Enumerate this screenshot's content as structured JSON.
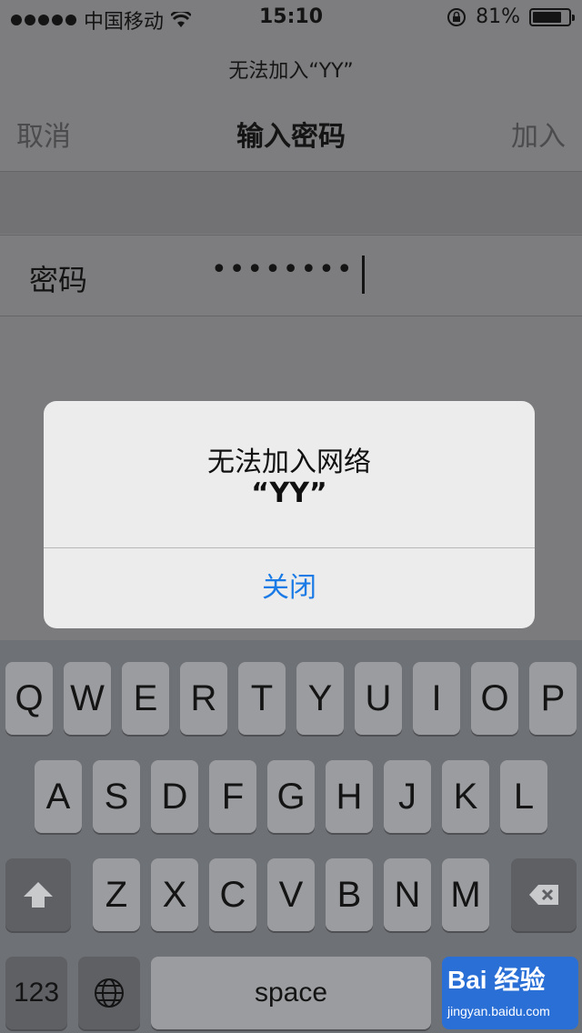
{
  "status_bar": {
    "carrier": "中国移动",
    "time": "15:10",
    "battery": "81%"
  },
  "nav": {
    "prompt": "无法加入“YY”",
    "cancel": "取消",
    "title": "输入密码",
    "join": "加入"
  },
  "password_row": {
    "label": "密码",
    "value": "••••••••"
  },
  "alert": {
    "title": "无法加入网络",
    "network": "“YY”",
    "button": "关闭",
    "button_color": "#1a7ae6"
  },
  "keyboard": {
    "row1": [
      "Q",
      "W",
      "E",
      "R",
      "T",
      "Y",
      "U",
      "I",
      "O",
      "P"
    ],
    "row2": [
      "A",
      "S",
      "D",
      "F",
      "G",
      "H",
      "J",
      "K",
      "L"
    ],
    "row3": [
      "Z",
      "X",
      "C",
      "V",
      "B",
      "N",
      "M"
    ],
    "numbers": "123",
    "space": "space",
    "shift_icon": "shift-icon",
    "delete_icon": "delete-icon",
    "globe_icon": "globe-icon"
  },
  "watermark": {
    "brand": "Bai 经验",
    "url": "jingyan.baidu.com"
  }
}
